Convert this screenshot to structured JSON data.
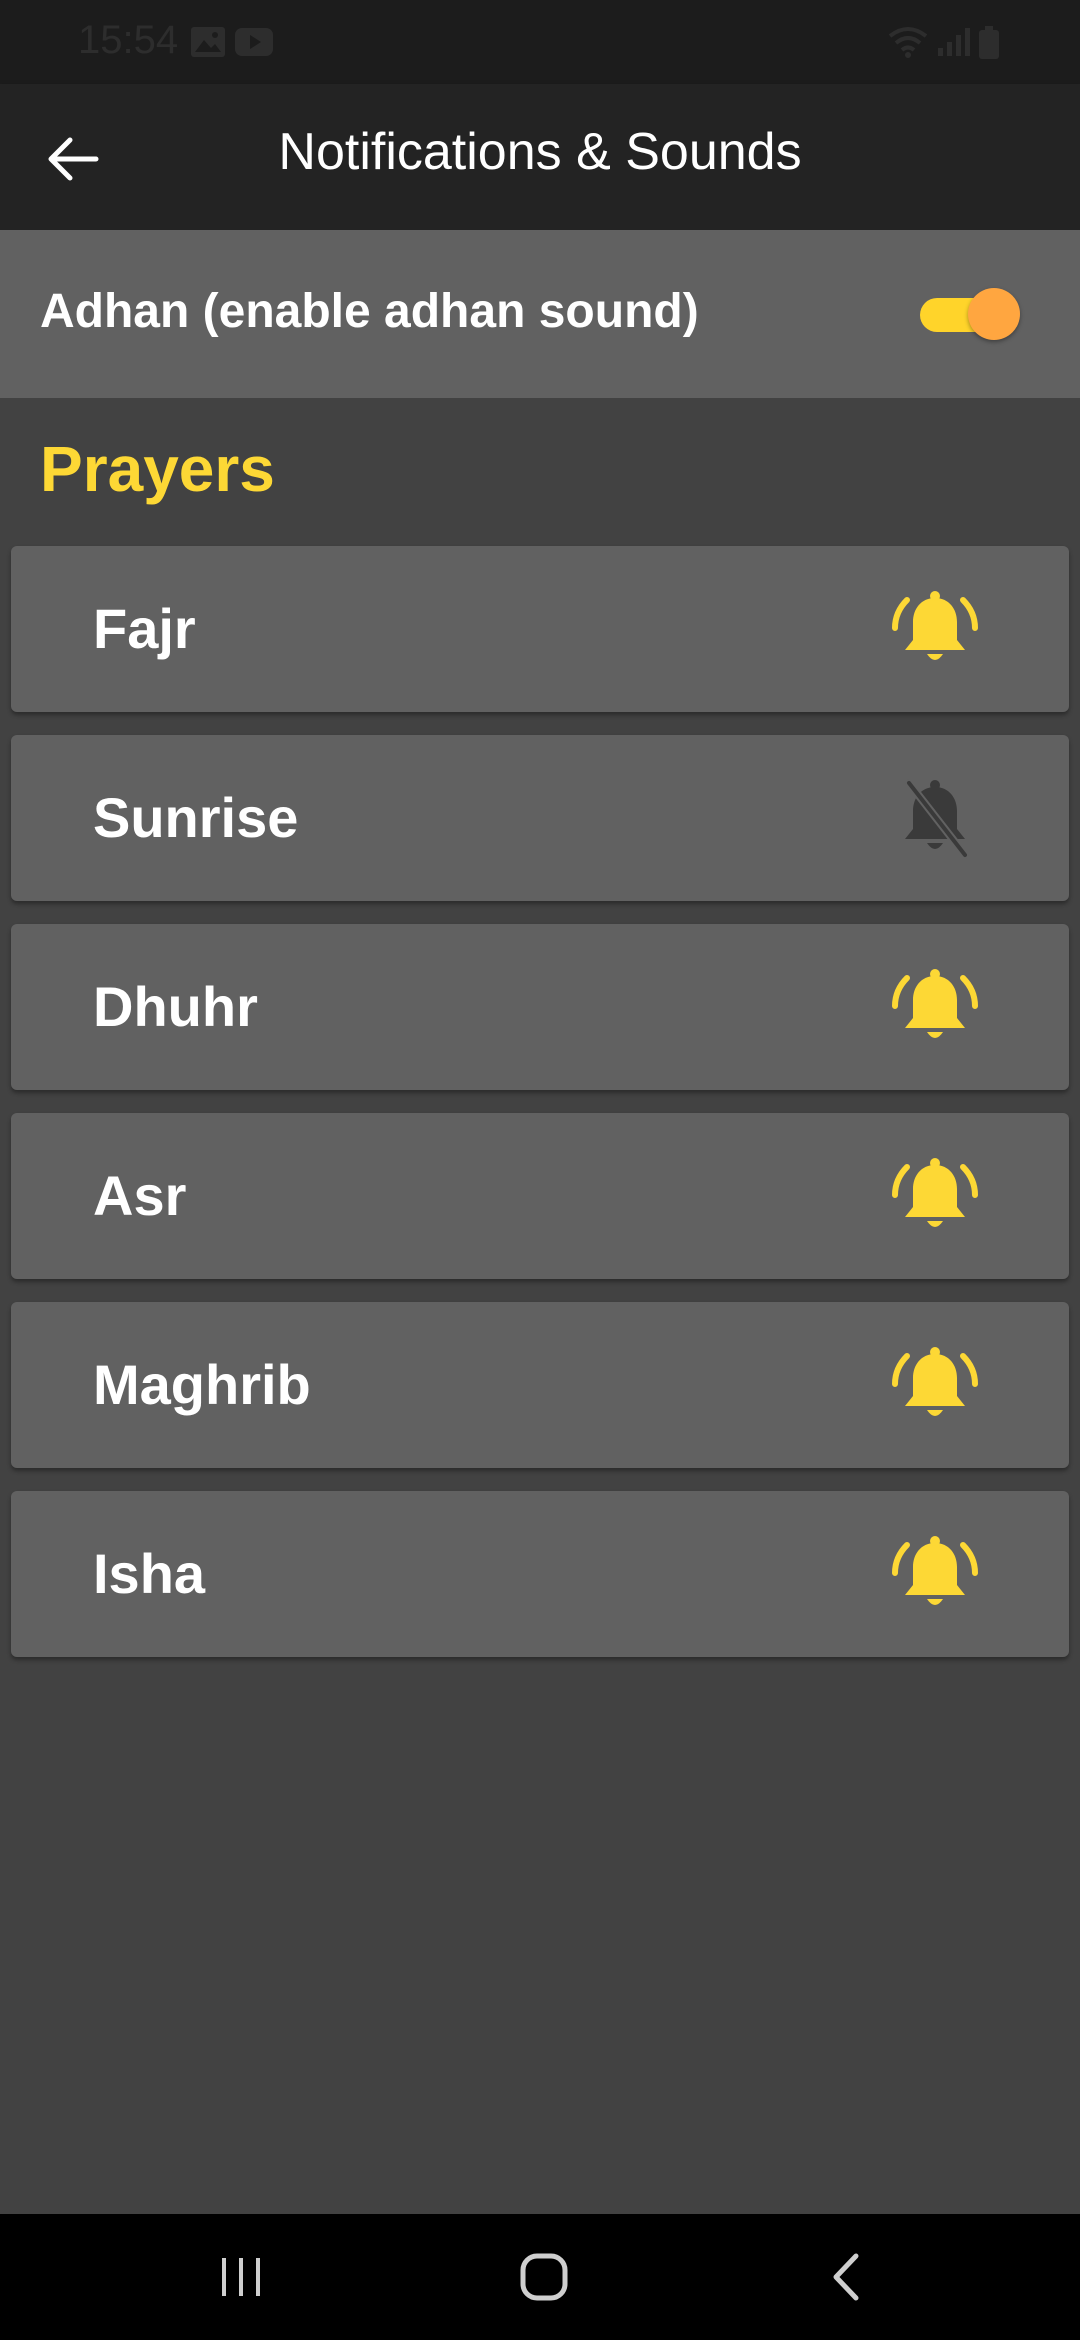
{
  "status_bar": {
    "time": "15:54",
    "icons": [
      "image-icon",
      "youtube-icon",
      "wifi-icon",
      "signal-icon",
      "battery-icon"
    ]
  },
  "app_bar": {
    "back_icon": "arrow-left-icon",
    "title": "Notifications & Sounds"
  },
  "adhan": {
    "label": "Adhan (enable adhan sound)",
    "enabled": true
  },
  "prayers": {
    "section_title": "Prayers",
    "items": [
      {
        "name": "Fajr",
        "notify": true
      },
      {
        "name": "Sunrise",
        "notify": false
      },
      {
        "name": "Dhuhr",
        "notify": true
      },
      {
        "name": "Asr",
        "notify": true
      },
      {
        "name": "Maghrib",
        "notify": true
      },
      {
        "name": "Isha",
        "notify": true
      }
    ]
  },
  "nav_bar": {
    "buttons": [
      "recents-icon",
      "home-icon",
      "back-icon"
    ]
  },
  "colors": {
    "accent": "#fdd835",
    "bell_on": "#fdd835",
    "bell_off": "#3a3a3a",
    "toggle_track": "#ffd42a",
    "toggle_thumb": "#ffa640",
    "background": "#424242",
    "row": "#616161",
    "app_bar": "#232323"
  }
}
